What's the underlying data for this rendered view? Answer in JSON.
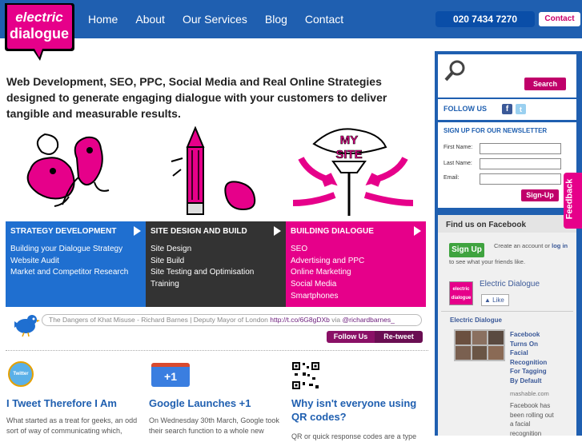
{
  "brand": {
    "line1": "electric",
    "line2": "dialogue"
  },
  "nav": {
    "home": "Home",
    "about": "About",
    "services": "Our Services",
    "blog": "Blog",
    "contact": "Contact"
  },
  "header": {
    "phone": "020 7434 7270",
    "contact_button": "Contact"
  },
  "tagline": "Web Development, SEO, PPC, Social Media and Real Online Strategies designed to generate engaging dialogue with your customers to deliver tangible and measurable results.",
  "illustrations": {
    "sign_text_1": "MY",
    "sign_text_2": "SITE"
  },
  "services": [
    {
      "title": "STRATEGY DEVELOPMENT",
      "items": [
        "Building your Dialogue Strategy",
        "Website Audit",
        "Market and Competitor Research"
      ]
    },
    {
      "title": "SITE DESIGN AND BUILD",
      "items": [
        "Site Design",
        "Site Build",
        "Site Testing and Optimisation",
        "Training"
      ]
    },
    {
      "title": "BUILDING DIALOGUE",
      "items": [
        "SEO",
        "Advertising and PPC",
        "Online Marketing",
        "Social Media",
        "Smartphones"
      ]
    }
  ],
  "twitter": {
    "tweet": "The Dangers of Khat Misuse - Richard Barnes | Deputy Mayor of London",
    "link": "http://t.co/6G8gDXb",
    "via": "via",
    "handle": "@richardbarnes_",
    "follow_label": "Follow Us",
    "retweet_label": "Re-tweet"
  },
  "posts": [
    {
      "badge": "Twitter",
      "title": "I Tweet Therefore I Am",
      "excerpt": "What started as a treat for geeks, an odd sort of way of communicating which,"
    },
    {
      "badge": "+1",
      "title": "Google Launches +1",
      "excerpt": "On Wednesday 30th March, Google took their search function to a whole new"
    },
    {
      "badge": "",
      "title": "Why isn't everyone using QR codes?",
      "excerpt": "QR or quick response codes are a type"
    }
  ],
  "sidebar": {
    "search_button": "Search",
    "follow_us": "FOLLOW US",
    "newsletter_title": "SIGN UP FOR OUR NEWSLETTER",
    "first_name_label": "First Name:",
    "last_name_label": "Last Name:",
    "email_label": "Email:",
    "signup_button": "Sign-Up",
    "facebook": {
      "title": "Find us on Facebook",
      "signup": "Sign Up",
      "prompt_pre": "Create an account or",
      "prompt_login": "log in",
      "prompt_post": "to see what your friends like.",
      "page_name": "Electric Dialogue",
      "like": "Like",
      "feed_header": "Electric Dialogue",
      "story_title": "Facebook Turns On Facial Recognition For Tagging By Default",
      "story_source": "mashable.com",
      "story_excerpt": "Facebook has been rolling out a facial recognition"
    }
  },
  "feedback_tab": "Feedback",
  "colors": {
    "brand_blue": "#1f5fb0",
    "brand_pink": "#e6008a",
    "dark": "#333333"
  }
}
